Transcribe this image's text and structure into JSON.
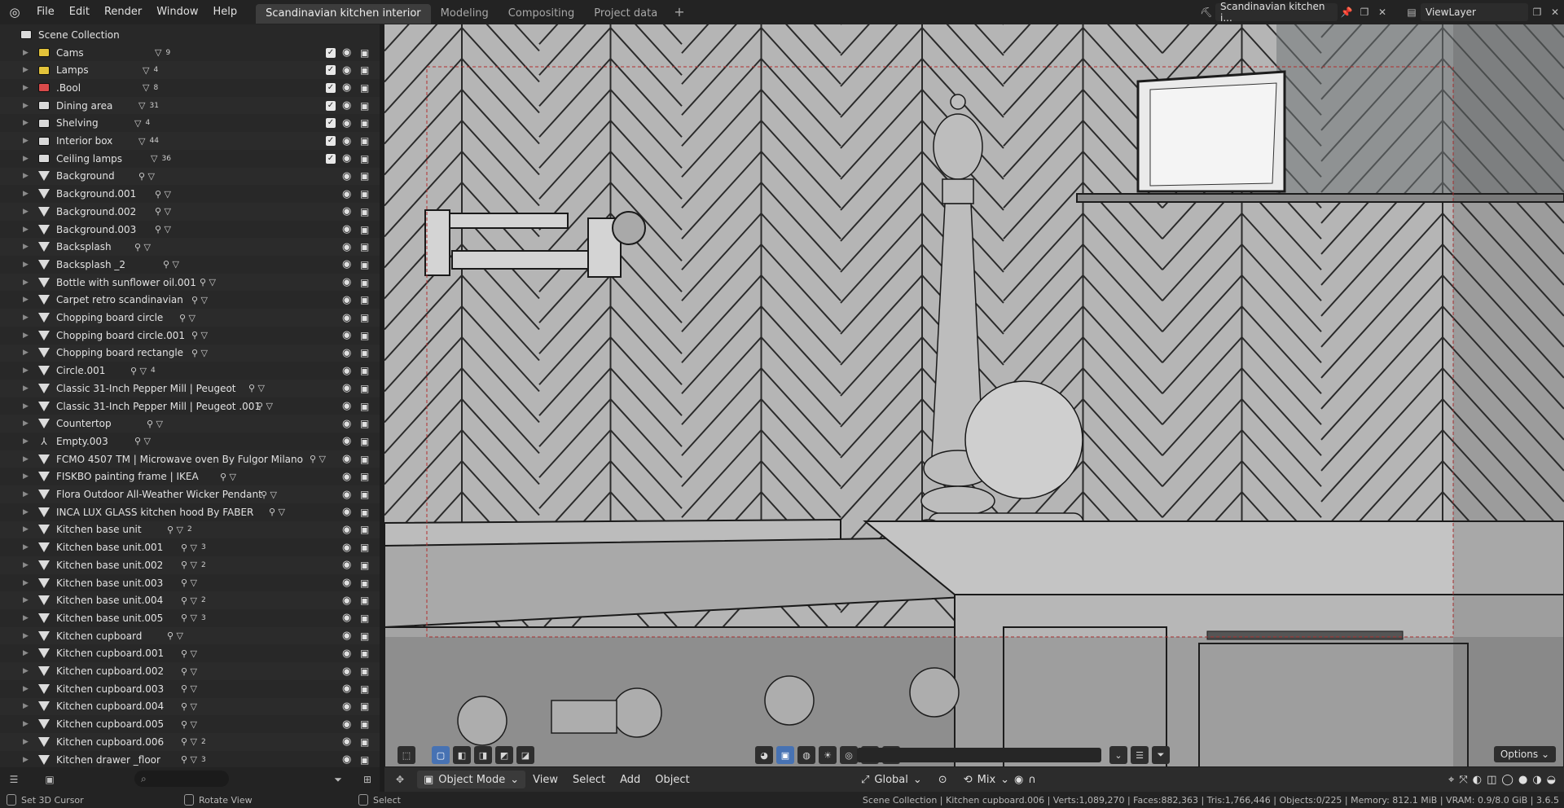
{
  "topbar": {
    "menu": [
      "File",
      "Edit",
      "Render",
      "Window",
      "Help"
    ],
    "workspaces": [
      "Scandinavian kitchen interior",
      "Modeling",
      "Compositing",
      "Project data"
    ],
    "active_workspace": "Scandinavian kitchen interior",
    "scene_name": "Scandinavian kitchen i...",
    "view_layer": "ViewLayer"
  },
  "outliner": {
    "root": "Scene Collection",
    "rows": [
      {
        "label": "Cams",
        "kind": "collection",
        "color": "yellow",
        "extra": "9",
        "checked": true
      },
      {
        "label": "Lamps",
        "kind": "collection",
        "color": "yellow",
        "extra": "4",
        "checked": true
      },
      {
        "label": ".Bool",
        "kind": "collection",
        "color": "red",
        "extra": "8",
        "checked": true
      },
      {
        "label": "Dining area",
        "kind": "collection",
        "color": "white",
        "extra": "31",
        "checked": true
      },
      {
        "label": "Shelving",
        "kind": "collection",
        "color": "white",
        "extra": "4",
        "checked": true
      },
      {
        "label": "Interior box",
        "kind": "collection",
        "color": "white",
        "extra": "44",
        "checked": true
      },
      {
        "label": "Ceiling lamps",
        "kind": "collection",
        "color": "white",
        "extra": "36",
        "checked": true
      },
      {
        "label": "Background",
        "kind": "mesh",
        "extra": ""
      },
      {
        "label": "Background.001",
        "kind": "mesh",
        "extra": ""
      },
      {
        "label": "Background.002",
        "kind": "mesh",
        "extra": ""
      },
      {
        "label": "Background.003",
        "kind": "mesh",
        "extra": ""
      },
      {
        "label": "Backsplash",
        "kind": "mesh",
        "extra": ""
      },
      {
        "label": "Backsplash _2",
        "kind": "mesh",
        "extra": ""
      },
      {
        "label": "Bottle with sunflower oil.001",
        "kind": "mesh",
        "extra": ""
      },
      {
        "label": "Carpet retro scandinavian",
        "kind": "mesh",
        "extra": ""
      },
      {
        "label": "Chopping board circle",
        "kind": "mesh",
        "extra": ""
      },
      {
        "label": "Chopping board circle.001",
        "kind": "mesh",
        "extra": ""
      },
      {
        "label": "Chopping board rectangle",
        "kind": "mesh",
        "extra": ""
      },
      {
        "label": "Circle.001",
        "kind": "mesh",
        "extra": "4"
      },
      {
        "label": "Classic 31-Inch Pepper Mill | Peugeot",
        "kind": "mesh",
        "extra": ""
      },
      {
        "label": "Classic 31-Inch Pepper Mill | Peugeot .001",
        "kind": "mesh",
        "extra": ""
      },
      {
        "label": "Countertop",
        "kind": "mesh",
        "extra": ""
      },
      {
        "label": "Empty.003",
        "kind": "empty",
        "extra": ""
      },
      {
        "label": "FCMO 4507 TM | Microwave oven By Fulgor Milano",
        "kind": "mesh",
        "extra": ""
      },
      {
        "label": "FISKBO painting frame | IKEA",
        "kind": "mesh",
        "extra": ""
      },
      {
        "label": "Flora Outdoor All-Weather Wicker Pendant",
        "kind": "mesh",
        "extra": ""
      },
      {
        "label": "INCA LUX GLASS kitchen hood By FABER",
        "kind": "mesh",
        "extra": ""
      },
      {
        "label": "Kitchen base unit",
        "kind": "mesh",
        "extra": "2"
      },
      {
        "label": "Kitchen base unit.001",
        "kind": "mesh",
        "extra": "3"
      },
      {
        "label": "Kitchen base unit.002",
        "kind": "mesh",
        "extra": "2"
      },
      {
        "label": "Kitchen base unit.003",
        "kind": "mesh",
        "extra": ""
      },
      {
        "label": "Kitchen base unit.004",
        "kind": "mesh",
        "extra": "2"
      },
      {
        "label": "Kitchen base unit.005",
        "kind": "mesh",
        "extra": "3"
      },
      {
        "label": "Kitchen cupboard",
        "kind": "mesh",
        "extra": ""
      },
      {
        "label": "Kitchen cupboard.001",
        "kind": "mesh",
        "extra": ""
      },
      {
        "label": "Kitchen cupboard.002",
        "kind": "mesh",
        "extra": ""
      },
      {
        "label": "Kitchen cupboard.003",
        "kind": "mesh",
        "extra": ""
      },
      {
        "label": "Kitchen cupboard.004",
        "kind": "mesh",
        "extra": ""
      },
      {
        "label": "Kitchen cupboard.005",
        "kind": "mesh",
        "extra": ""
      },
      {
        "label": "Kitchen cupboard.006",
        "kind": "mesh",
        "extra": "2"
      },
      {
        "label": "Kitchen drawer _floor",
        "kind": "mesh",
        "extra": "3"
      }
    ]
  },
  "viewport": {
    "header": {
      "mode": "Object Mode",
      "menus": [
        "View",
        "Select",
        "Add",
        "Object"
      ],
      "orientation": "Global",
      "mix": "Mix"
    },
    "options_label": "Options"
  },
  "statusbar": {
    "left1": "Set 3D Cursor",
    "left2": "Rotate View",
    "left3": "Select",
    "stats": "Scene Collection | Kitchen cupboard.006 | Verts:1,089,270 | Faces:882,363 | Tris:1,766,446 | Objects:0/225 | Memory: 812.1 MiB | VRAM: 0.9/8.0 GiB | 3.6.5"
  }
}
